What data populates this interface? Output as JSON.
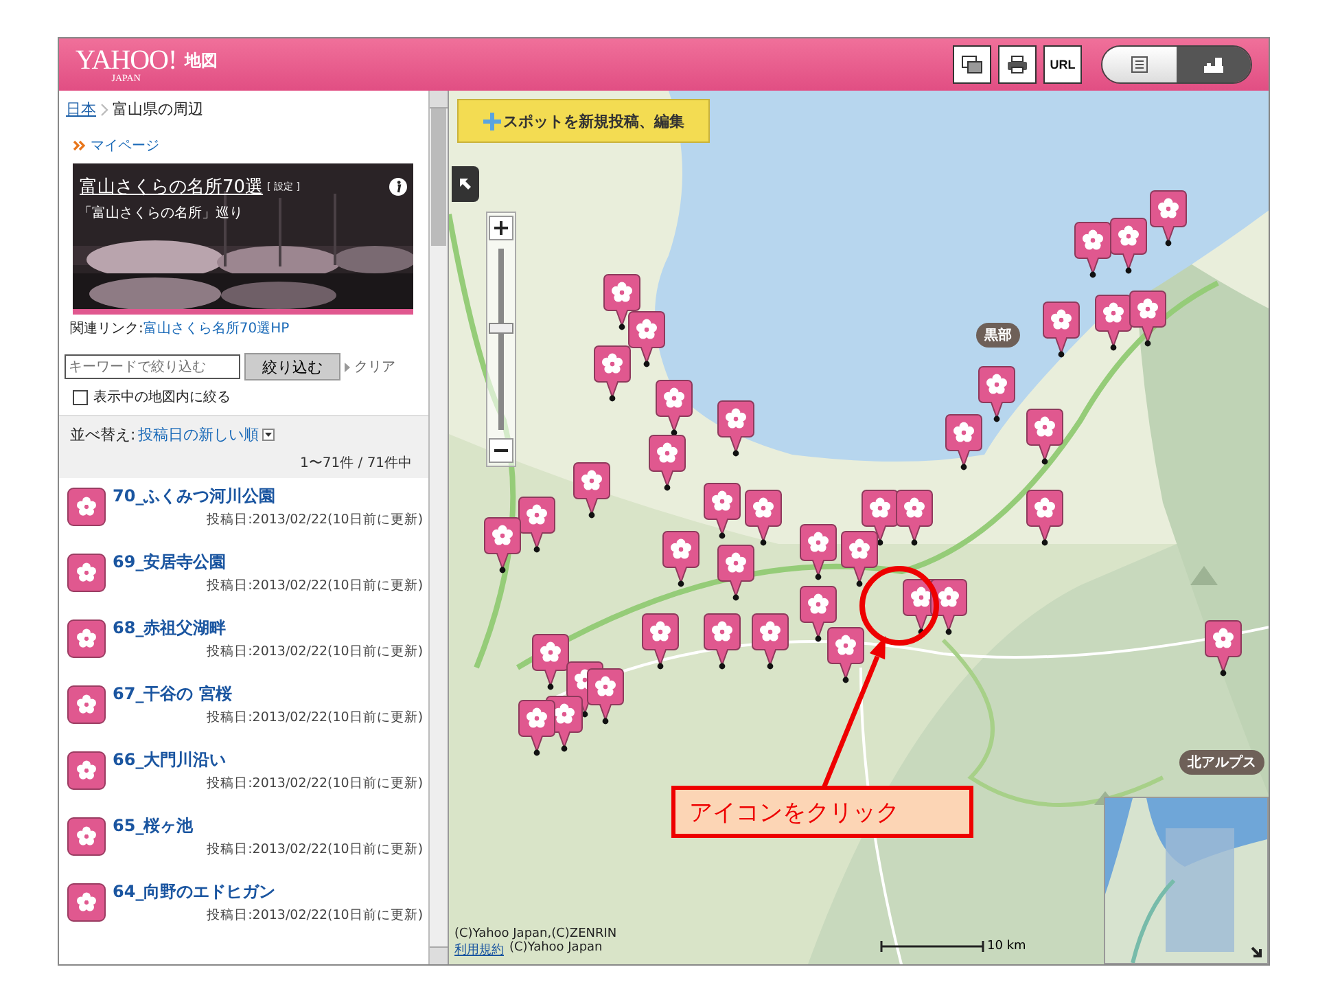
{
  "header": {
    "logo": "YAHOO!",
    "logo_sub": "JAPAN",
    "service": "地図",
    "tools": [
      {
        "kind": "window"
      },
      {
        "kind": "print"
      },
      {
        "kind": "url",
        "label": "URL"
      }
    ],
    "view_toggle": [
      {
        "kind": "list",
        "selected": false
      },
      {
        "kind": "map",
        "selected": true
      }
    ]
  },
  "breadcrumb": [
    "日本",
    "富山県の周辺"
  ],
  "mypage_link": "マイページ",
  "banner": {
    "title": "富山さくらの名所70選",
    "settings": "[ 設定 ]",
    "subtitle": "「富山さくらの名所」巡り"
  },
  "related": {
    "label": "関連リンク:",
    "link": "富山さくら名所70選HP"
  },
  "filter": {
    "placeholder": "キーワードで絞り込む",
    "button": "絞り込む",
    "clear": "クリア",
    "checkbox": {
      "label": "表示中の地図内に絞る",
      "checked": false
    }
  },
  "sort": {
    "label": "並べ替え:",
    "value": "投稿日の新しい順"
  },
  "count": "1〜71件 / 71件中",
  "items": [
    {
      "title": "70_ふくみつ河川公園",
      "date": "投稿日:2013/02/22(10日前に更新)"
    },
    {
      "title": "69_安居寺公園",
      "date": "投稿日:2013/02/22(10日前に更新)"
    },
    {
      "title": "68_赤祖父湖畔",
      "date": "投稿日:2013/02/22(10日前に更新)"
    },
    {
      "title": "67_干谷の 宮桜",
      "date": "投稿日:2013/02/22(10日前に更新)"
    },
    {
      "title": "66_大門川沿い",
      "date": "投稿日:2013/02/22(10日前に更新)"
    },
    {
      "title": "65_桜ヶ池",
      "date": "投稿日:2013/02/22(10日前に更新)"
    },
    {
      "title": "64_向野のエドヒガン",
      "date": "投稿日:2013/02/22(10日前に更新)"
    }
  ],
  "map": {
    "add_spot_button": "スポットを新規投稿、編集",
    "zoom": {
      "level": 0.56
    },
    "area_labels": [
      "黒部",
      "北アルプス"
    ],
    "copyright": "(C)Yahoo Japan,(C)ZENRIN",
    "terms_link": "利用規約",
    "copyright_2": "(C)Yahoo Japan",
    "scale": "10 km",
    "annotation": "アイコンをクリック"
  }
}
